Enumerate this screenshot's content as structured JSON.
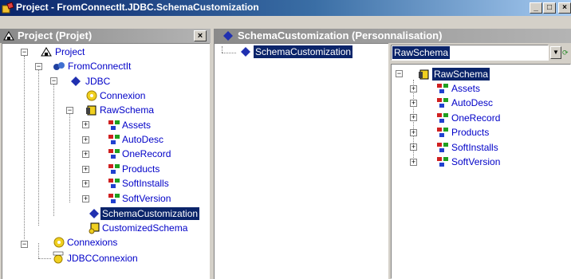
{
  "window": {
    "title": "Project - FromConnectIt.JDBC.SchemaCustomization",
    "minimize": "_",
    "maximize": "□",
    "close": "×"
  },
  "left_pane": {
    "title": "Project (Projet)",
    "close": "×",
    "tree": [
      {
        "label": "Project",
        "icon": "project-icon"
      },
      {
        "label": "FromConnectIt",
        "icon": "connection-icon"
      },
      {
        "label": "JDBC",
        "icon": "jdbc-icon"
      },
      {
        "label": "Connexion",
        "icon": "gear-icon"
      },
      {
        "label": "RawSchema",
        "icon": "schema-icon"
      },
      {
        "label": "Assets",
        "icon": "table-icon"
      },
      {
        "label": "AutoDesc",
        "icon": "table-icon"
      },
      {
        "label": "OneRecord",
        "icon": "table-icon"
      },
      {
        "label": "Products",
        "icon": "table-icon"
      },
      {
        "label": "SoftInstalls",
        "icon": "table-icon"
      },
      {
        "label": "SoftVersion",
        "icon": "table-icon"
      },
      {
        "label": "SchemaCustomization",
        "icon": "diamond-icon"
      },
      {
        "label": "CustomizedSchema",
        "icon": "custom-schema-icon"
      },
      {
        "label": "Connexions",
        "icon": "gear-icon"
      },
      {
        "label": "JDBCConnexion",
        "icon": "jdbc-connexion-icon"
      }
    ]
  },
  "right_pane": {
    "title": "SchemaCustomization (Personnalisation)",
    "middle_item": "SchemaCustomization",
    "combo_value": "RawSchema",
    "tree": [
      {
        "label": "RawSchema",
        "icon": "schema-icon"
      },
      {
        "label": "Assets",
        "icon": "table-icon"
      },
      {
        "label": "AutoDesc",
        "icon": "table-icon"
      },
      {
        "label": "OneRecord",
        "icon": "table-icon"
      },
      {
        "label": "Products",
        "icon": "table-icon"
      },
      {
        "label": "SoftInstalls",
        "icon": "table-icon"
      },
      {
        "label": "SoftVersion",
        "icon": "table-icon"
      }
    ]
  },
  "tree_expander_plus": "+",
  "tree_expander_minus": "−",
  "colors": {
    "title_bar": "#0a246a",
    "selection": "#0a246a",
    "link_text": "#0000c8",
    "pane_background": "#d4d0c8"
  }
}
